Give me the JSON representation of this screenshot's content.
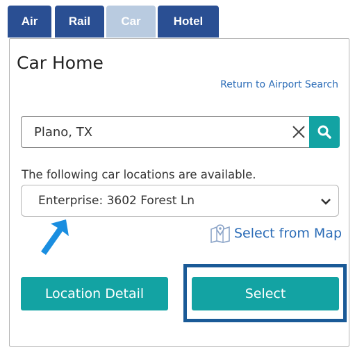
{
  "tabs": [
    {
      "label": "Air"
    },
    {
      "label": "Rail"
    },
    {
      "label": "Car"
    },
    {
      "label": "Hotel"
    }
  ],
  "page": {
    "title": "Car Home",
    "return_link": "Return to Airport Search"
  },
  "search": {
    "value": "Plano, TX"
  },
  "locations": {
    "intro": "The following car locations are available.",
    "selected": "Enterprise: 3602 Forest Ln"
  },
  "map_link": "Select from Map",
  "buttons": {
    "detail": "Location Detail",
    "select": "Select"
  },
  "colors": {
    "tab_dark": "#2a4f93",
    "tab_active": "#b9cbe0",
    "teal": "#13a3a3",
    "link": "#2b6cb7",
    "highlight": "#1a5a97",
    "arrow": "#1a8ee0"
  }
}
